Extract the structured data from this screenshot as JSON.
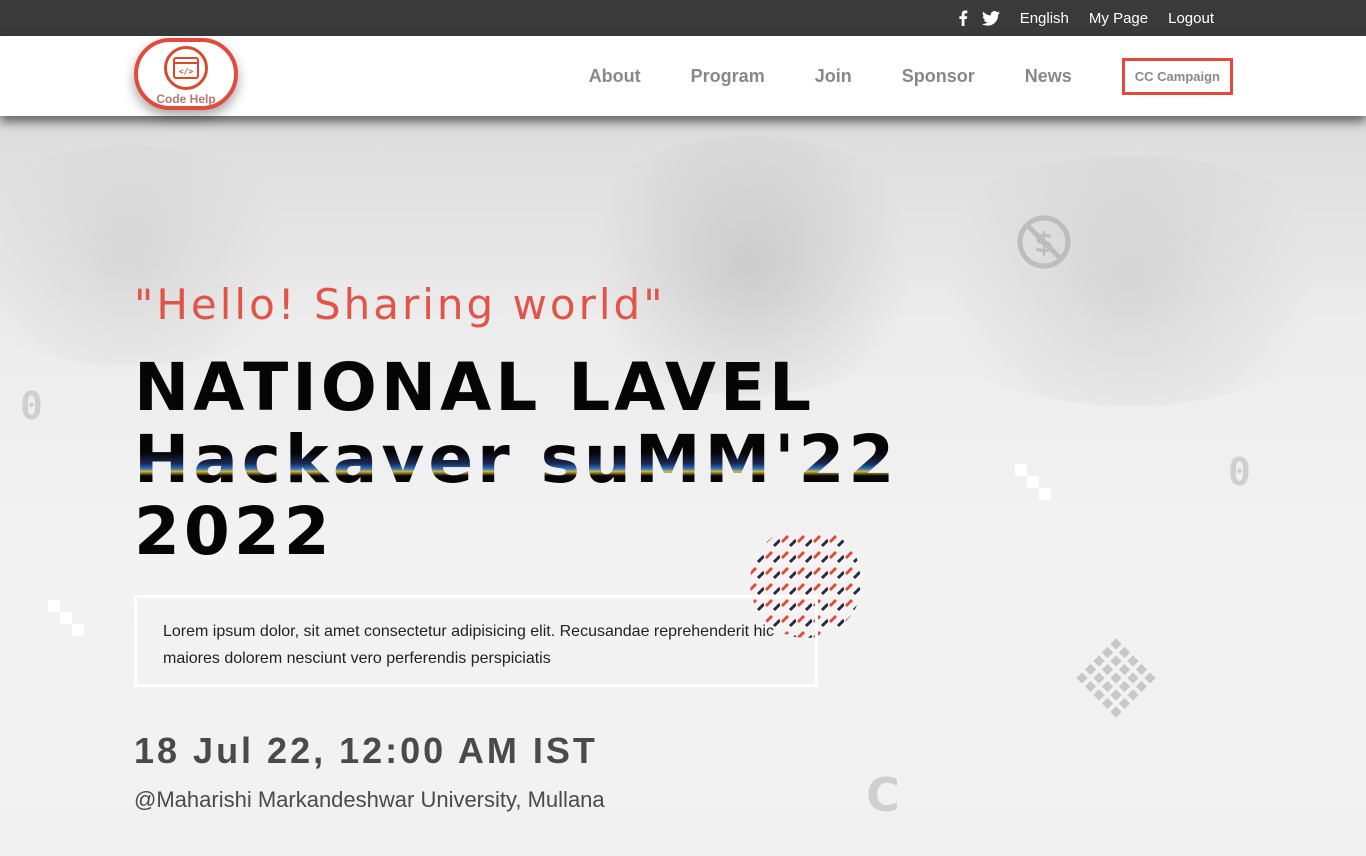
{
  "topbar": {
    "icons": [
      "facebook-icon",
      "twitter-icon"
    ],
    "links": [
      "English",
      "My Page",
      "Logout"
    ]
  },
  "logo": {
    "caption": "Code Help",
    "glyph": "</>"
  },
  "nav": {
    "items": [
      "About",
      "Program",
      "Join",
      "Sponsor",
      "News"
    ],
    "cta": "CC Campaign"
  },
  "hero": {
    "tagline": "\"Hello! Sharing world\"",
    "headline": [
      "NATIONAL LAVEL",
      "Hackaver suMM'22",
      "2022"
    ],
    "description": "Lorem ipsum dolor, sit amet consectetur adipisicing elit. Recusandae reprehenderit hic maiores dolorem nesciunt vero perferendis perspiciatis",
    "datetime": "18 Jul 22, 12:00 AM IST",
    "venue": "@Maharishi Markandeshwar University, Mullana"
  },
  "decor": {
    "zero_glyph": "0",
    "dollar_icon": "no-dollar-icon",
    "c_glyph": "C"
  },
  "colors": {
    "accent": "#e24b3b",
    "topbar_bg": "#3a3a3a",
    "tagline": "#e05548",
    "nav_text": "#888888"
  }
}
